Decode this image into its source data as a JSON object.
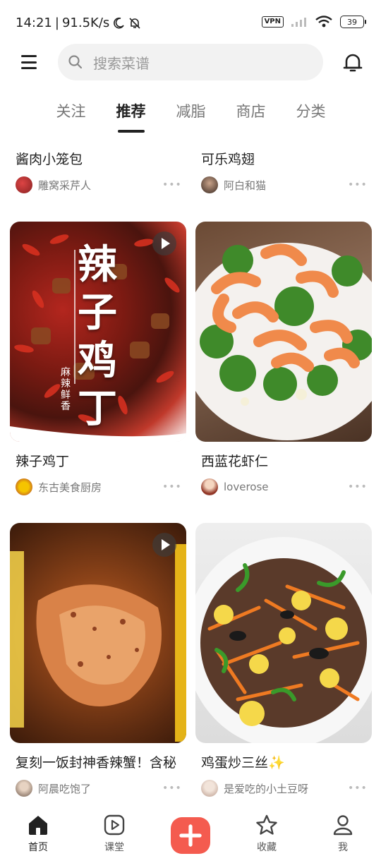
{
  "status_bar": {
    "time": "14:21",
    "separator": "|",
    "speed": "91.5K/s",
    "vpn": "VPN",
    "battery": "39"
  },
  "search": {
    "placeholder": "搜索菜谱"
  },
  "tabs": [
    {
      "label": "关注",
      "active": false
    },
    {
      "label": "推荐",
      "active": true
    },
    {
      "label": "减脂",
      "active": false
    },
    {
      "label": "商店",
      "active": false
    },
    {
      "label": "分类",
      "active": false
    }
  ],
  "feed": {
    "top_partial": [
      {
        "title": "酱肉小笼包",
        "author": "雕窝采芹人",
        "more": "•••"
      },
      {
        "title": "可乐鸡翅",
        "author": "阿白和猫",
        "more": "•••"
      }
    ],
    "cards": [
      {
        "title": "辣子鸡丁",
        "author": "东古美食厨房",
        "more": "•••",
        "video": true,
        "cover_text": "辣子鸡丁",
        "cover_sub": "麻辣鲜香"
      },
      {
        "title": "西蓝花虾仁",
        "author": "loverose",
        "more": "•••",
        "video": false
      },
      {
        "title": "复刻一饭封神香辣蟹！含秘",
        "author": "阿晨吃饱了",
        "more": "•••",
        "video": true
      },
      {
        "title": "鸡蛋炒三丝✨",
        "author": "是爱吃的小土豆呀",
        "more": "•••",
        "video": false
      }
    ]
  },
  "bottom_nav": [
    {
      "label": "首页",
      "icon": "home-icon",
      "active": true
    },
    {
      "label": "课堂",
      "icon": "play-square-icon",
      "active": false
    },
    {
      "label": "",
      "icon": "plus-icon",
      "active": false
    },
    {
      "label": "收藏",
      "icon": "star-icon",
      "active": false
    },
    {
      "label": "我",
      "icon": "person-icon",
      "active": false
    }
  ],
  "colors": {
    "accent": "#f45b4f",
    "text": "#222222",
    "muted": "#777777"
  }
}
